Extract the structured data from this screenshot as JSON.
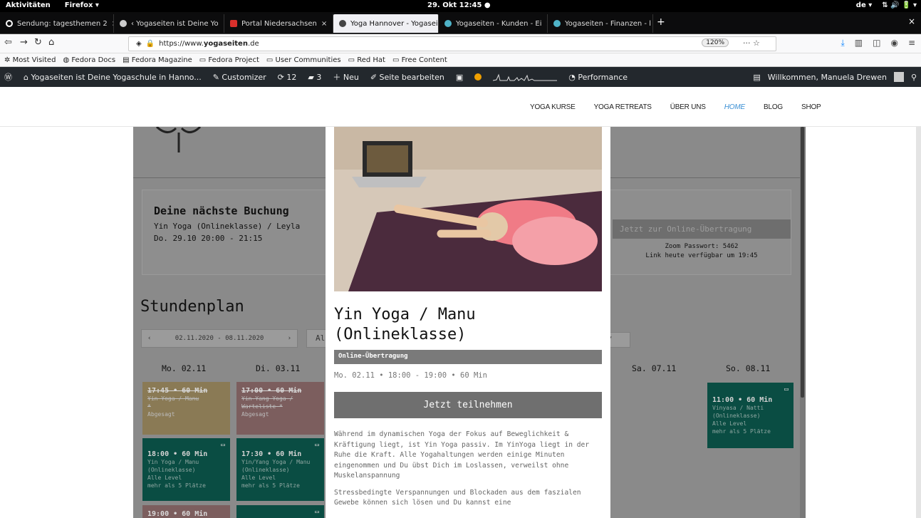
{
  "system": {
    "activities": "Aktivitäten",
    "app_menu": "Firefox ▾",
    "clock": "29. Okt  12:45  ●",
    "lang": "de ▾",
    "status_icons": "⇅  🔊  🔋 ▾"
  },
  "browser": {
    "tabs": [
      {
        "label": "Sendung: tagesthemen 2",
        "fav_color": "#ffffff"
      },
      {
        "label": "‹ Yogaseiten ist Deine Yo",
        "fav_color": "#cccccc"
      },
      {
        "label": "Portal Niedersachsen",
        "fav_color": "#d9302c"
      },
      {
        "label": "Yoga Hannover - Yogasei",
        "fav_color": "#444444"
      },
      {
        "label": "Yogaseiten - Kunden - Ei",
        "fav_color": "#4fb3c8"
      },
      {
        "label": "Yogaseiten - Finanzen - l",
        "fav_color": "#4fb3c8"
      }
    ],
    "close_glyph": "×",
    "new_tab": "+",
    "url_scheme": "https://www.",
    "url_host": "yogaseiten",
    "url_tld": ".de",
    "zoom": "120%",
    "page_actions": "···  ☆",
    "bookmarks": [
      "Most Visited",
      "Fedora Docs",
      "Fedora Magazine",
      "Fedora Project",
      "User Communities",
      "Red Hat",
      "Free Content"
    ]
  },
  "wpadmin": {
    "site_name": "Yogaseiten ist Deine Yogaschule in Hanno...",
    "customizer": "Customizer",
    "updates": "12",
    "comments": "3",
    "new": "Neu",
    "edit": "Seite bearbeiten",
    "performance": "Performance",
    "greeting": "Willkommen, Manuela Drewen"
  },
  "site_menu": [
    "YOGA KURSE",
    "YOGA RETREATS",
    "ÜBER UNS",
    "HOME",
    "BLOG",
    "SHOP"
  ],
  "booking": {
    "title": "Deine nächste Buchung",
    "class": "Yin Yoga (Onlineklasse) / Leyla",
    "time": "Do. 29.10 20:00 - 21:15",
    "stream_button": "Jetzt zur Online-Übertragung",
    "password": "Zoom Passwort: 5462",
    "available": "Link heute verfügbar um 19:45"
  },
  "schedule": {
    "title": "Stundenplan",
    "range": "02.11.2020 - 08.11.2020",
    "prev": "‹",
    "next": "›",
    "filter_left": "Al",
    "filter_right": "▾",
    "days": [
      "Mo. 02.11",
      "Di. 03.11",
      "Sa. 07.11",
      "So. 08.11"
    ],
    "cards": [
      {
        "time": "17:45 • 60 Min",
        "name": "Yin Yoga / Manu",
        "extra": "*",
        "status": "Abgesagt"
      },
      {
        "time": "17:00 • 60 Min",
        "name": "Yin-Yang Yoga /",
        "extra": "Warteliste *",
        "status": "Abgesagt"
      },
      {
        "time": "18:00 • 60 Min",
        "name": "Yin Yoga / Manu",
        "extra": "(Onlineklasse)",
        "level": "Alle Level",
        "spots": "mehr als 5 Plätze"
      },
      {
        "time": "17:30 • 60 Min",
        "name": "Yin/Yang Yoga / Manu",
        "extra": "(Onlineklasse)",
        "level": "Alle Level",
        "spots": "mehr als 5 Plätze"
      },
      {
        "time": "11:00 • 60 Min",
        "name": "Vinyasa / Natti",
        "extra": "(Onlineklasse)",
        "level": "Alle Level",
        "spots": "mehr als 5 Plätze"
      },
      {
        "time": "19:00 • 60 Min"
      }
    ]
  },
  "modal": {
    "title": "Yin Yoga / Manu (Onlineklasse)",
    "badge": "Online-Übertragung",
    "meta": "Mo. 02.11 • 18:00 - 19:00 • 60 Min",
    "join": "Jetzt teilnehmen",
    "desc1": "Während im dynamischen Yoga der Fokus auf Beweglichkeit & Kräftigung liegt, ist Yin Yoga passiv. Im YinYoga liegt in der Ruhe die Kraft. Alle Yogahaltungen werden einige Minuten eingenommen und Du übst Dich im Loslassen, verweilst ohne Muskelanspannung",
    "desc2": "Stressbedingte Verspannungen und Blockaden aus dem faszialen Gewebe können sich lösen und Du kannst eine"
  }
}
